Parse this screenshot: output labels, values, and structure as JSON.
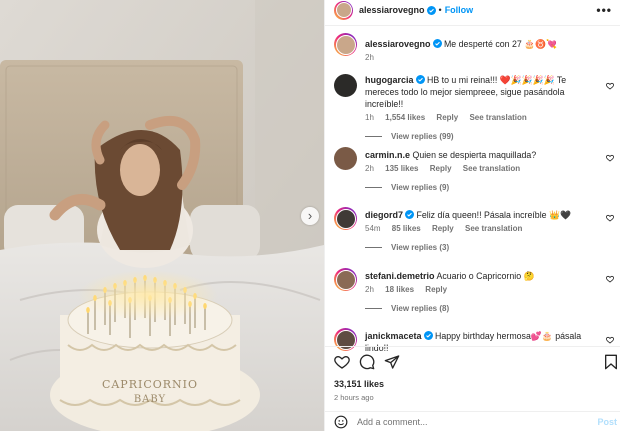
{
  "post": {
    "author": "alessiarovegno",
    "follow_label": "Follow",
    "separator": "•",
    "more_label": "•••",
    "next_label": "›"
  },
  "caption": {
    "username": "alessiarovegno",
    "text": "Me desperté con 27 🎂♉💘",
    "time": "2h"
  },
  "comments": [
    {
      "username": "hugogarcia",
      "verified": true,
      "text": "HB to u mi reina!!! ❤️🎉🎉🎉🎉 Te mereces todo lo mejor siempreee, sigue pasándola increíble!!",
      "time": "1h",
      "likes": "1,554 likes",
      "reply": "Reply",
      "translate": "See translation",
      "replies": "View replies (99)"
    },
    {
      "username": "carmin.n.e",
      "verified": false,
      "text": "Quien se despierta maquillada?",
      "time": "2h",
      "likes": "135 likes",
      "reply": "Reply",
      "translate": "See translation",
      "replies": "View replies (9)"
    },
    {
      "username": "diegord7",
      "verified": true,
      "text": "Feliz día queen!! Pásala increíble 👑🖤",
      "time": "54m",
      "likes": "85 likes",
      "reply": "Reply",
      "translate": "See translation",
      "replies": "View replies (3)"
    },
    {
      "username": "stefani.demetrio",
      "verified": false,
      "text": "Acuario o Capricornio 🤔",
      "time": "2h",
      "likes": "18 likes",
      "reply": "Reply",
      "translate": "",
      "replies": "View replies (8)"
    },
    {
      "username": "janickmaceta",
      "verified": true,
      "text": "Happy birthday hermosa💕🎂 pásala lindo!!"
    }
  ],
  "footer": {
    "likes": "33,151 likes",
    "time": "2 hours ago",
    "comment_placeholder": "Add a comment...",
    "post_label": "Post"
  },
  "photo": {
    "cake_text_line1": "CAPRICORNIO",
    "cake_text_line2": "BABY"
  },
  "colors": {
    "accent": "#0095f6",
    "verified": "#0095f6",
    "text": "#262626",
    "secondary": "#737373"
  }
}
